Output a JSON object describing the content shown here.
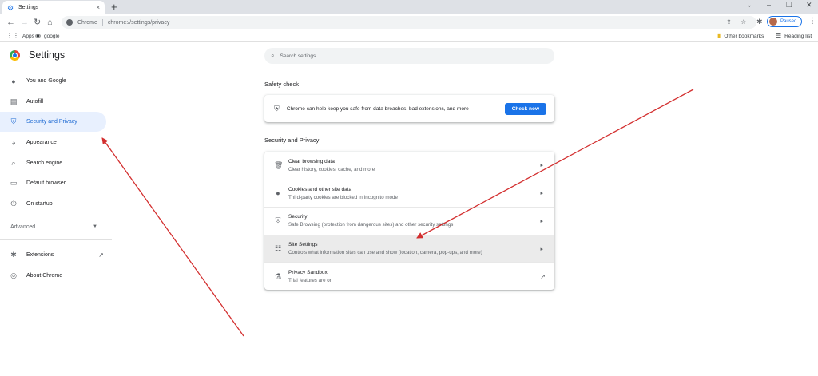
{
  "browser": {
    "tab_title": "Settings",
    "tab_close": "×",
    "new_tab": "+",
    "omnibox_chip": "Chrome",
    "url": "chrome://settings/privacy",
    "profile_label": "Paused",
    "bookmarks": [
      {
        "icon": "apps-icon",
        "label": "Apps"
      },
      {
        "icon": "google-icon",
        "label": "google"
      }
    ],
    "other_bookmarks": "Other bookmarks",
    "reading_list": "Reading list"
  },
  "sidebar": {
    "title": "Settings",
    "items": [
      {
        "icon": "person-icon",
        "label": "You and Google"
      },
      {
        "icon": "clipboard-icon",
        "label": "Autofill"
      },
      {
        "icon": "shield-icon",
        "label": "Security and Privacy",
        "active": true
      },
      {
        "icon": "palette-icon",
        "label": "Appearance"
      },
      {
        "icon": "search-icon",
        "label": "Search engine"
      },
      {
        "icon": "browser-icon",
        "label": "Default browser"
      },
      {
        "icon": "power-icon",
        "label": "On startup"
      }
    ],
    "advanced": "Advanced",
    "extensions": "Extensions",
    "about": "About Chrome"
  },
  "main": {
    "search_placeholder": "Search settings",
    "safety_check": {
      "heading": "Safety check",
      "text": "Chrome can help keep you safe from data breaches, bad extensions, and more",
      "button": "Check now"
    },
    "privacy": {
      "heading": "Security and Privacy",
      "rows": [
        {
          "icon": "trash-icon",
          "title": "Clear browsing data",
          "subtitle": "Clear history, cookies, cache, and more"
        },
        {
          "icon": "cookie-icon",
          "title": "Cookies and other site data",
          "subtitle": "Third-party cookies are blocked in Incognito mode"
        },
        {
          "icon": "shield-icon",
          "title": "Security",
          "subtitle": "Safe Browsing (protection from dangerous sites) and other security settings"
        },
        {
          "icon": "sliders-icon",
          "title": "Site Settings",
          "subtitle": "Controls what information sites can use and show (location, camera, pop-ups, and more)"
        },
        {
          "icon": "flask-icon",
          "title": "Privacy Sandbox",
          "subtitle": "Trial features are on"
        }
      ]
    }
  },
  "colors": {
    "accent": "#1a73e8",
    "active_bg": "#e8f0fe",
    "annotation_arrow": "#d32f2f"
  }
}
